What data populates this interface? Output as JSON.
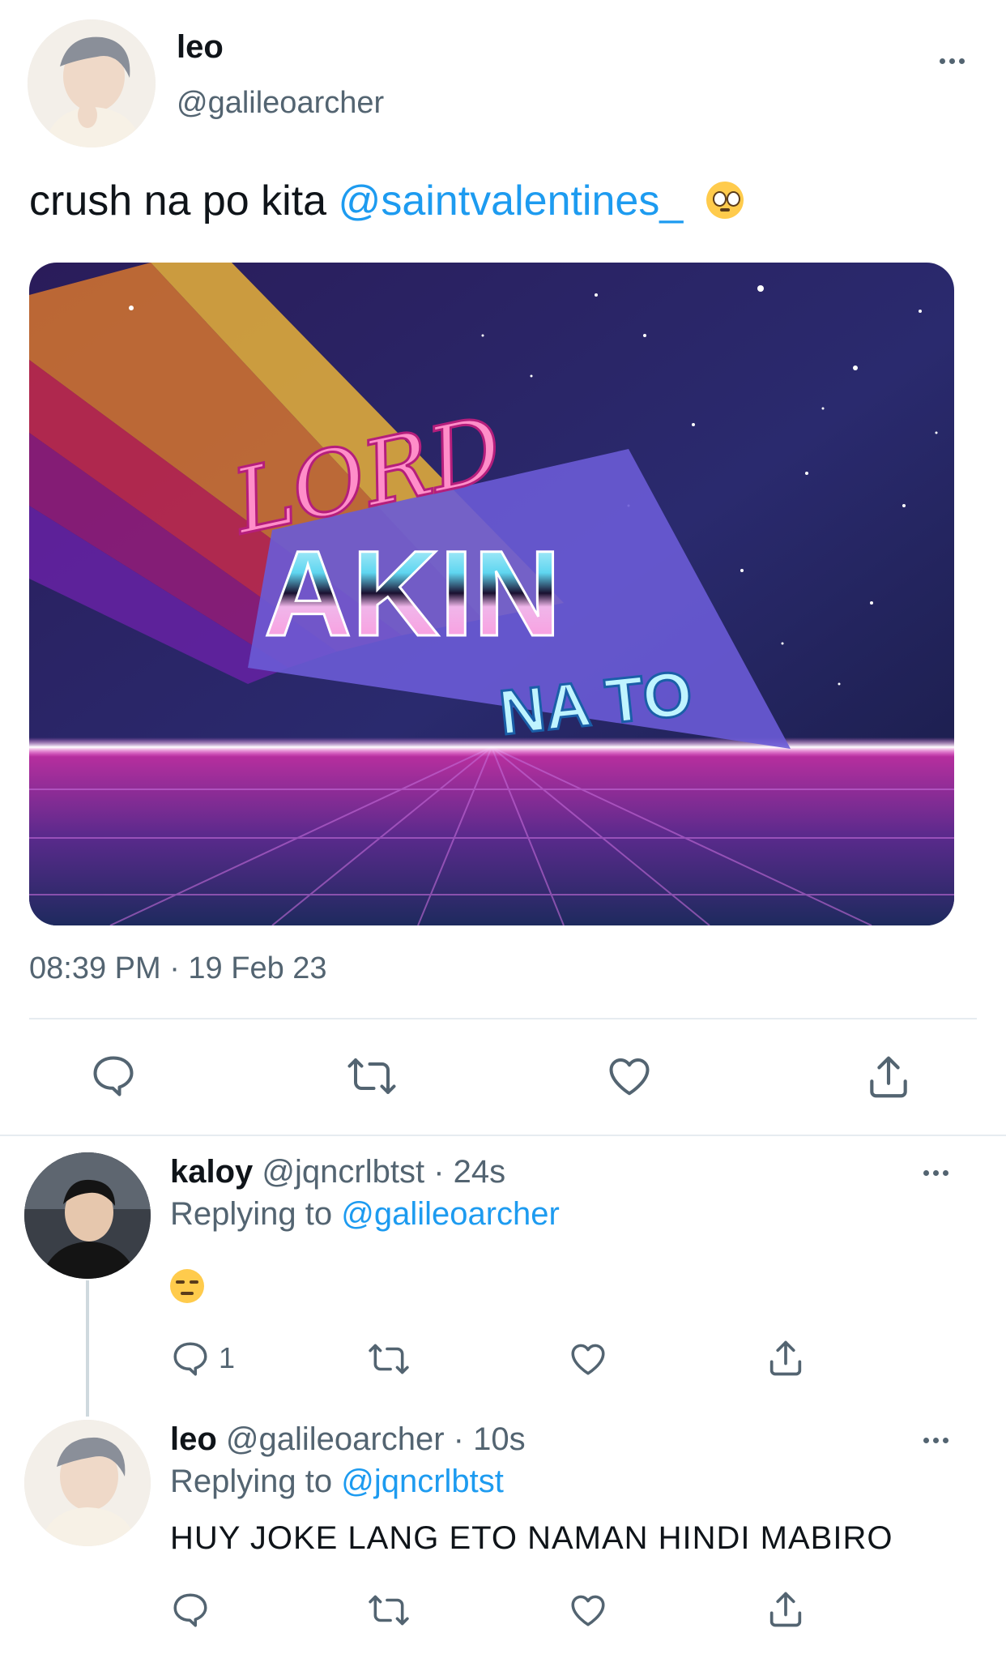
{
  "main_tweet": {
    "display_name": "leo",
    "handle": "@galileoarcher",
    "text_before": "crush na po kita ",
    "mention": "@saintvalentines_",
    "emoji": "pleading-face-emoji",
    "image": {
      "line1": "LORD",
      "line2": "AKIN",
      "line3": "NA TO"
    },
    "timestamp": "08:39 PM · 19 Feb 23"
  },
  "replies": [
    {
      "display_name": "kaloy",
      "meta": "@jqncrlbtst · 24s",
      "replying_label": "Replying to ",
      "replying_to": "@galileoarcher",
      "emoji": "unamused-face-emoji",
      "reply_count": "1"
    },
    {
      "display_name": "leo",
      "meta": "@galileoarcher · 10s",
      "replying_label": "Replying to ",
      "replying_to": "@jqncrlbtst",
      "text": "HUY JOKE LANG ETO NAMAN HINDI MABIRO"
    }
  ],
  "icons": [
    "more-icon",
    "reply-icon",
    "retweet-icon",
    "like-icon",
    "share-icon"
  ],
  "colors": {
    "accent": "#1d9bf0",
    "text": "#0f1419",
    "secondary": "#536471",
    "divider": "#e6ecf0"
  }
}
